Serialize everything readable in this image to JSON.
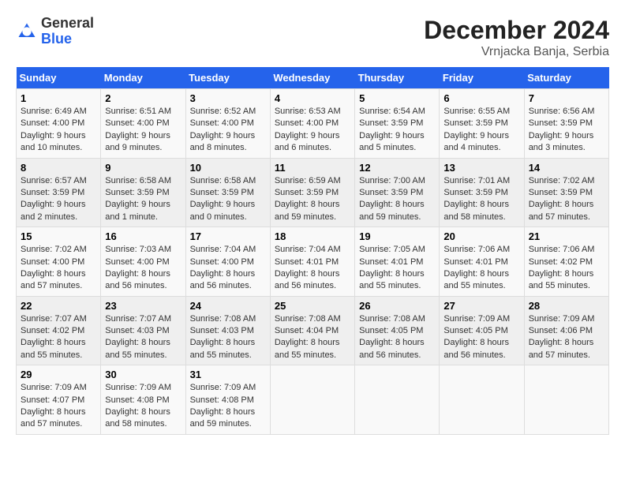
{
  "header": {
    "logo_general": "General",
    "logo_blue": "Blue",
    "month_year": "December 2024",
    "location": "Vrnjacka Banja, Serbia"
  },
  "days_of_week": [
    "Sunday",
    "Monday",
    "Tuesday",
    "Wednesday",
    "Thursday",
    "Friday",
    "Saturday"
  ],
  "weeks": [
    [
      {
        "day": 1,
        "sunrise": "6:49 AM",
        "sunset": "4:00 PM",
        "daylight": "9 hours and 10 minutes."
      },
      {
        "day": 2,
        "sunrise": "6:51 AM",
        "sunset": "4:00 PM",
        "daylight": "9 hours and 9 minutes."
      },
      {
        "day": 3,
        "sunrise": "6:52 AM",
        "sunset": "4:00 PM",
        "daylight": "9 hours and 8 minutes."
      },
      {
        "day": 4,
        "sunrise": "6:53 AM",
        "sunset": "4:00 PM",
        "daylight": "9 hours and 6 minutes."
      },
      {
        "day": 5,
        "sunrise": "6:54 AM",
        "sunset": "3:59 PM",
        "daylight": "9 hours and 5 minutes."
      },
      {
        "day": 6,
        "sunrise": "6:55 AM",
        "sunset": "3:59 PM",
        "daylight": "9 hours and 4 minutes."
      },
      {
        "day": 7,
        "sunrise": "6:56 AM",
        "sunset": "3:59 PM",
        "daylight": "9 hours and 3 minutes."
      }
    ],
    [
      {
        "day": 8,
        "sunrise": "6:57 AM",
        "sunset": "3:59 PM",
        "daylight": "9 hours and 2 minutes."
      },
      {
        "day": 9,
        "sunrise": "6:58 AM",
        "sunset": "3:59 PM",
        "daylight": "9 hours and 1 minute."
      },
      {
        "day": 10,
        "sunrise": "6:58 AM",
        "sunset": "3:59 PM",
        "daylight": "9 hours and 0 minutes."
      },
      {
        "day": 11,
        "sunrise": "6:59 AM",
        "sunset": "3:59 PM",
        "daylight": "8 hours and 59 minutes."
      },
      {
        "day": 12,
        "sunrise": "7:00 AM",
        "sunset": "3:59 PM",
        "daylight": "8 hours and 59 minutes."
      },
      {
        "day": 13,
        "sunrise": "7:01 AM",
        "sunset": "3:59 PM",
        "daylight": "8 hours and 58 minutes."
      },
      {
        "day": 14,
        "sunrise": "7:02 AM",
        "sunset": "3:59 PM",
        "daylight": "8 hours and 57 minutes."
      }
    ],
    [
      {
        "day": 15,
        "sunrise": "7:02 AM",
        "sunset": "4:00 PM",
        "daylight": "8 hours and 57 minutes."
      },
      {
        "day": 16,
        "sunrise": "7:03 AM",
        "sunset": "4:00 PM",
        "daylight": "8 hours and 56 minutes."
      },
      {
        "day": 17,
        "sunrise": "7:04 AM",
        "sunset": "4:00 PM",
        "daylight": "8 hours and 56 minutes."
      },
      {
        "day": 18,
        "sunrise": "7:04 AM",
        "sunset": "4:01 PM",
        "daylight": "8 hours and 56 minutes."
      },
      {
        "day": 19,
        "sunrise": "7:05 AM",
        "sunset": "4:01 PM",
        "daylight": "8 hours and 55 minutes."
      },
      {
        "day": 20,
        "sunrise": "7:06 AM",
        "sunset": "4:01 PM",
        "daylight": "8 hours and 55 minutes."
      },
      {
        "day": 21,
        "sunrise": "7:06 AM",
        "sunset": "4:02 PM",
        "daylight": "8 hours and 55 minutes."
      }
    ],
    [
      {
        "day": 22,
        "sunrise": "7:07 AM",
        "sunset": "4:02 PM",
        "daylight": "8 hours and 55 minutes."
      },
      {
        "day": 23,
        "sunrise": "7:07 AM",
        "sunset": "4:03 PM",
        "daylight": "8 hours and 55 minutes."
      },
      {
        "day": 24,
        "sunrise": "7:08 AM",
        "sunset": "4:03 PM",
        "daylight": "8 hours and 55 minutes."
      },
      {
        "day": 25,
        "sunrise": "7:08 AM",
        "sunset": "4:04 PM",
        "daylight": "8 hours and 55 minutes."
      },
      {
        "day": 26,
        "sunrise": "7:08 AM",
        "sunset": "4:05 PM",
        "daylight": "8 hours and 56 minutes."
      },
      {
        "day": 27,
        "sunrise": "7:09 AM",
        "sunset": "4:05 PM",
        "daylight": "8 hours and 56 minutes."
      },
      {
        "day": 28,
        "sunrise": "7:09 AM",
        "sunset": "4:06 PM",
        "daylight": "8 hours and 57 minutes."
      }
    ],
    [
      {
        "day": 29,
        "sunrise": "7:09 AM",
        "sunset": "4:07 PM",
        "daylight": "8 hours and 57 minutes."
      },
      {
        "day": 30,
        "sunrise": "7:09 AM",
        "sunset": "4:08 PM",
        "daylight": "8 hours and 58 minutes."
      },
      {
        "day": 31,
        "sunrise": "7:09 AM",
        "sunset": "4:08 PM",
        "daylight": "8 hours and 59 minutes."
      },
      null,
      null,
      null,
      null
    ]
  ]
}
